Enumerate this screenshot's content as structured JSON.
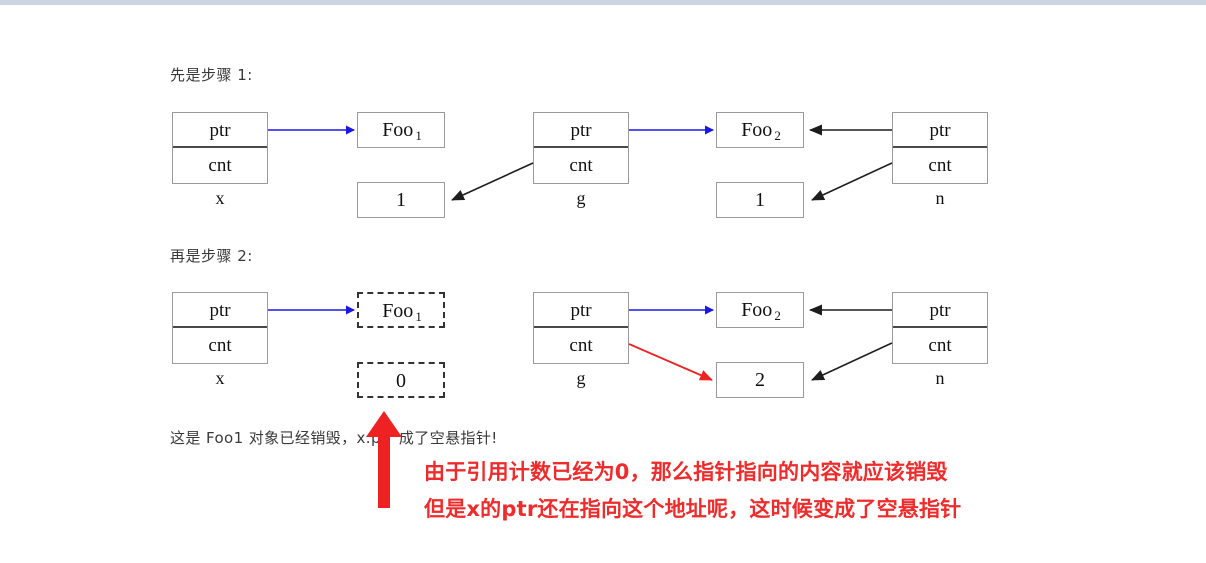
{
  "page": {
    "background": "#ffffff",
    "top_bar_color": "#ccd3e1",
    "arrow_blue": "#1818e8",
    "arrow_black": "#333333",
    "arrow_red": "#ee2222",
    "note_red": "#ef2b2b"
  },
  "step1": {
    "heading": "先是步骤 1:",
    "x_struct": {
      "ptr": "ptr",
      "cnt": "cnt",
      "name": "x"
    },
    "g_struct": {
      "ptr": "ptr",
      "cnt": "cnt",
      "name": "g"
    },
    "n_struct": {
      "ptr": "ptr",
      "cnt": "cnt",
      "name": "n"
    },
    "foo1_object": "Foo",
    "foo1_subscript": "1",
    "foo1_count": "1",
    "foo2_object": "Foo",
    "foo2_subscript": "2",
    "foo2_count": "1"
  },
  "step2": {
    "heading": "再是步骤 2:",
    "x_struct": {
      "ptr": "ptr",
      "cnt": "cnt",
      "name": "x"
    },
    "g_struct": {
      "ptr": "ptr",
      "cnt": "cnt",
      "name": "g"
    },
    "n_struct": {
      "ptr": "ptr",
      "cnt": "cnt",
      "name": "n"
    },
    "foo1_object": "Foo",
    "foo1_subscript": "1",
    "foo1_count": "0",
    "foo2_object": "Foo",
    "foo2_subscript": "2",
    "foo2_count": "2"
  },
  "notes": {
    "caption": "这是 Foo1 对象已经销毁，x.ptr 成了空悬指针!",
    "red_line1": "由于引用计数已经为0，那么指针指向的内容就应该销毁",
    "red_line2": "但是x的ptr还在指向这个地址呢，这时候变成了空悬指针"
  }
}
